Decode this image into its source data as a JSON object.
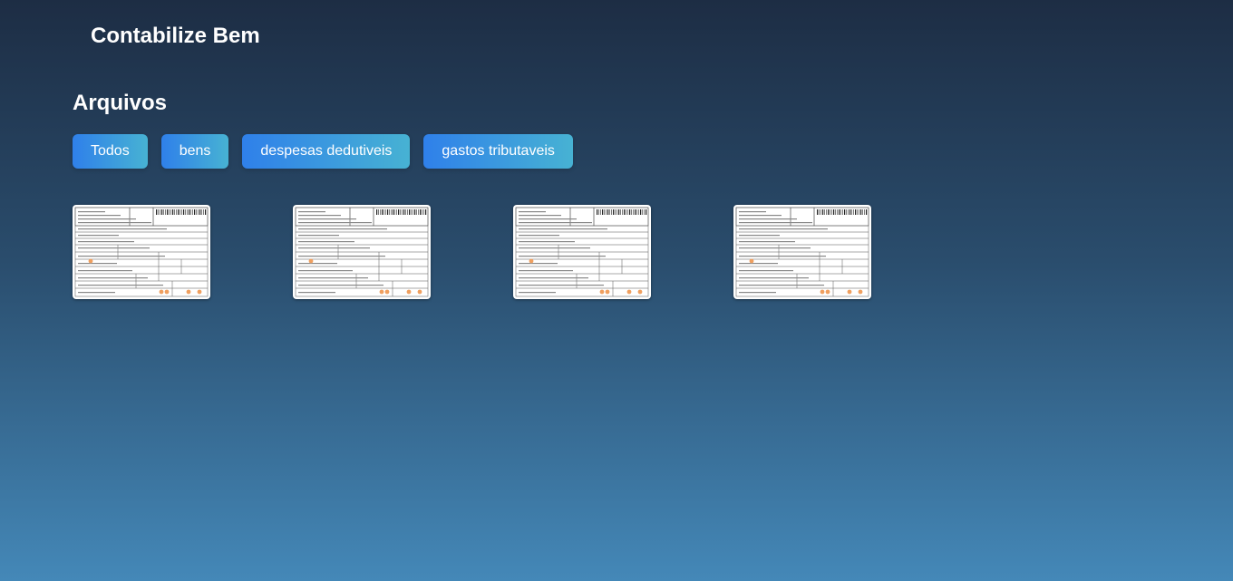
{
  "header": {
    "brand": "Contabilize Bem"
  },
  "main": {
    "title": "Arquivos",
    "filters": [
      {
        "label": "Todos"
      },
      {
        "label": "bens"
      },
      {
        "label": "despesas dedutiveis"
      },
      {
        "label": "gastos tributaveis"
      }
    ],
    "files": [
      {
        "kind": "invoice-document"
      },
      {
        "kind": "invoice-document"
      },
      {
        "kind": "invoice-document"
      },
      {
        "kind": "invoice-document"
      }
    ]
  },
  "colors": {
    "bg_top": "#1d2d44",
    "bg_bottom": "#4488b8",
    "button_start": "#2f80ea",
    "button_end": "#47b2d3",
    "accent_stamp": "#f0a060"
  }
}
